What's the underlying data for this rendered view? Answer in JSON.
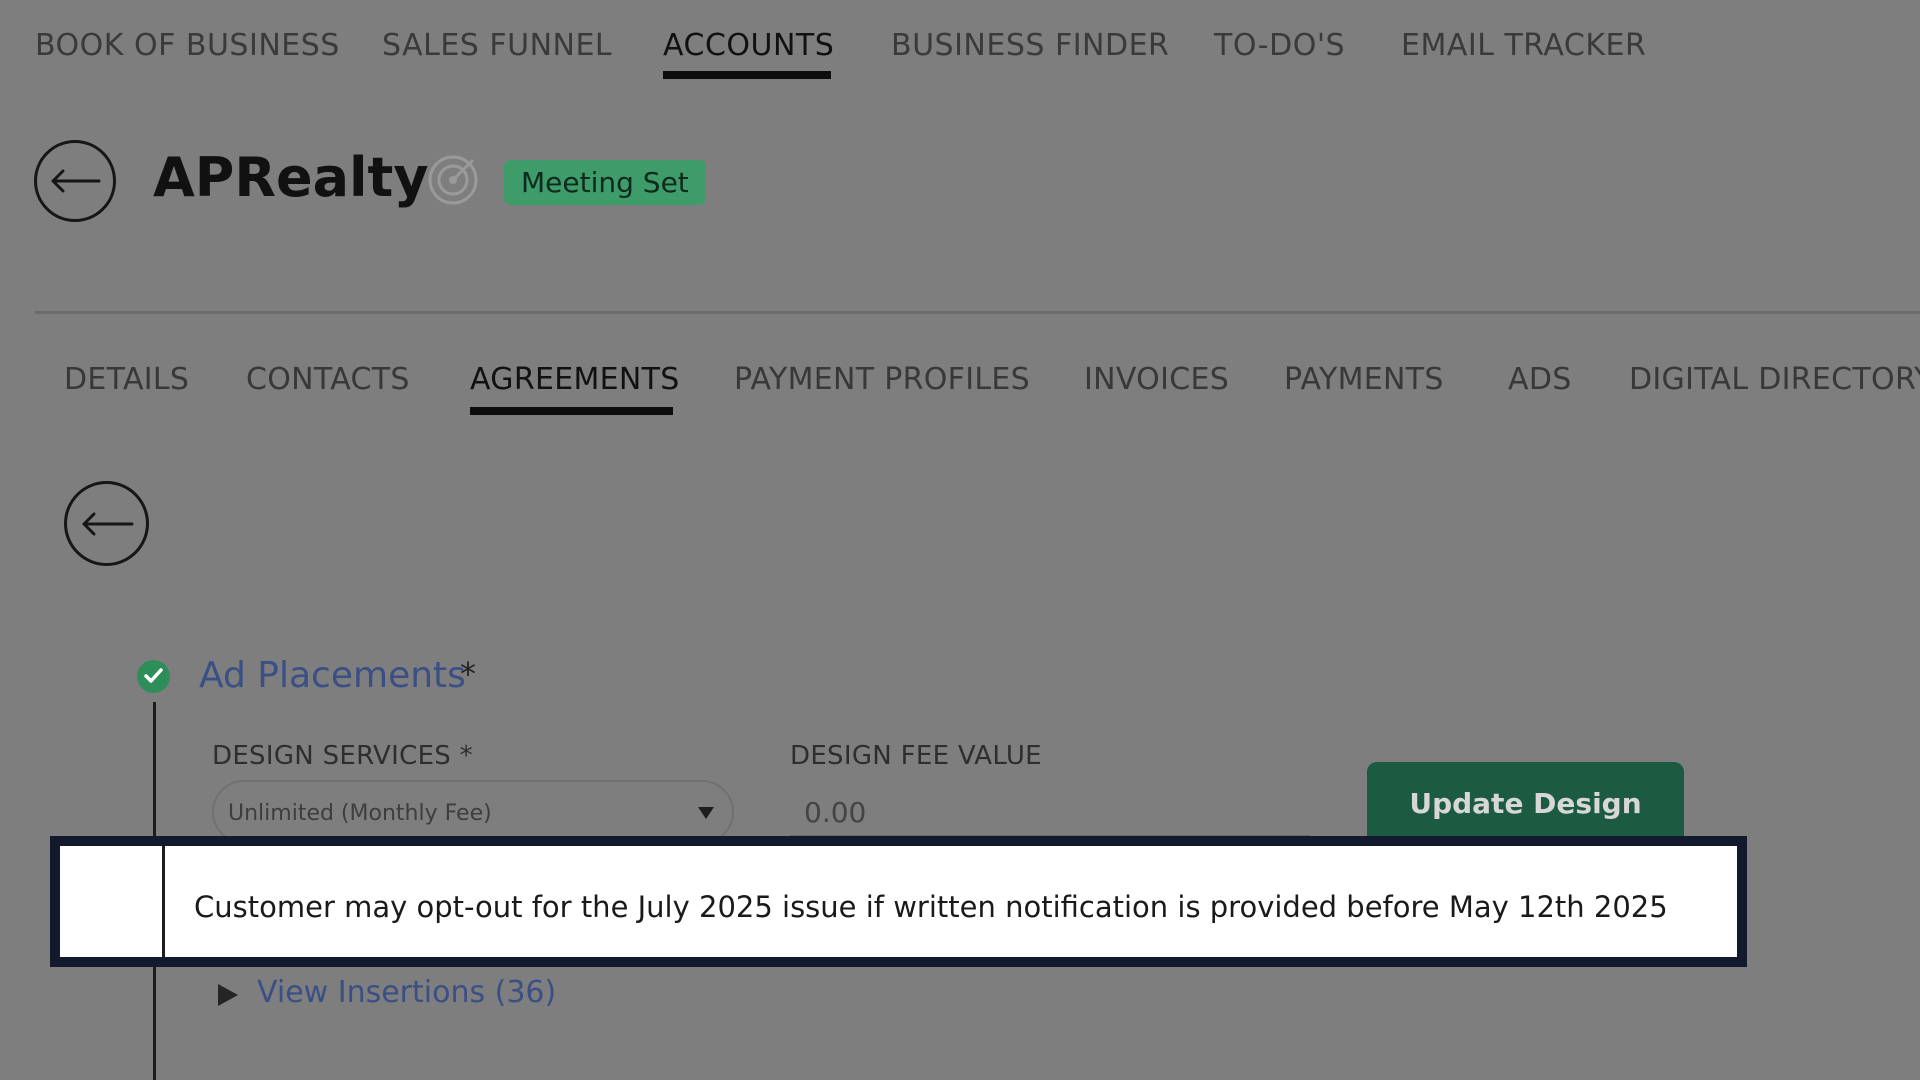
{
  "top_nav": {
    "items": [
      {
        "label": "BOOK OF BUSINESS"
      },
      {
        "label": "SALES FUNNEL"
      },
      {
        "label": "ACCOUNTS"
      },
      {
        "label": "BUSINESS FINDER"
      },
      {
        "label": "TO-DO'S"
      },
      {
        "label": "EMAIL TRACKER"
      }
    ],
    "active": "ACCOUNTS"
  },
  "account": {
    "name": "APRealty",
    "status_badge": "Meeting Set",
    "status_color": "#3d9c6a"
  },
  "sub_tabs": {
    "items": [
      {
        "label": "DETAILS"
      },
      {
        "label": "CONTACTS"
      },
      {
        "label": "AGREEMENTS"
      },
      {
        "label": "PAYMENT PROFILES"
      },
      {
        "label": "INVOICES"
      },
      {
        "label": "PAYMENTS"
      },
      {
        "label": "ADS"
      },
      {
        "label": "DIGITAL DIRECTORY"
      }
    ],
    "active": "AGREEMENTS"
  },
  "section": {
    "title": "Ad Placements",
    "required_marker": "*",
    "design_services": {
      "label": "DESIGN SERVICES *",
      "value": "Unlimited (Monthly Fee)"
    },
    "design_fee": {
      "label": "DESIGN FEE VALUE",
      "placeholder": "0.00"
    },
    "update_button": "Update Design",
    "notice": "Customer may opt-out for the July 2025 issue if written notification is provided before May 12th 2025",
    "view_insertions": "View Insertions (36)"
  },
  "icons": {
    "back": "arrow-left-icon",
    "target": "target-icon",
    "check": "check-circle-icon",
    "caret": "caret-down-icon",
    "expand": "play-icon"
  },
  "colors": {
    "overlay_bg": "#7e7e7e",
    "accent_green": "#1c5a42",
    "link_blue": "#3a4f86",
    "notice_border": "#141a2e"
  }
}
